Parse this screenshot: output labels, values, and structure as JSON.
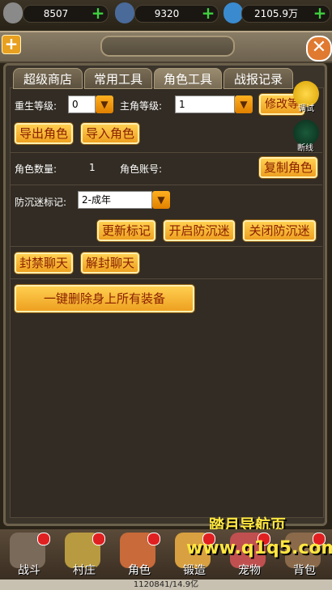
{
  "resources": [
    {
      "icon": "coin-icon",
      "value": "8507"
    },
    {
      "icon": "crystal-icon",
      "value": "9320"
    },
    {
      "icon": "gem-icon",
      "value": "2105.9万"
    }
  ],
  "tabs": [
    "超级商店",
    "常用工具",
    "角色工具",
    "战报记录"
  ],
  "form": {
    "rebirth_label": "重生等级:",
    "rebirth_value": "0",
    "main_level_label": "主角等级:",
    "main_level_value": "1",
    "modify_button": "修改等",
    "debug_label": "调试",
    "export_button": "导出角色",
    "import_button": "导入角色",
    "disconnect_label": "断线",
    "role_count_label": "角色数量:",
    "role_count_value": "1",
    "role_account_label": "角色账号:",
    "copy_role_button": "复制角色",
    "anti_addiction_label": "防沉迷标记:",
    "anti_addiction_value": "2-成年",
    "update_flag_button": "更新标记",
    "enable_anti_button": "开启防沉迷",
    "disable_anti_button": "关闭防沉迷",
    "ban_chat_button": "封禁聊天",
    "unban_chat_button": "解封聊天",
    "delete_equip_button": "一键删除身上所有装备"
  },
  "bottom_nav": [
    {
      "label": "战斗",
      "icon": "battle-icon"
    },
    {
      "label": "村庄",
      "icon": "village-icon"
    },
    {
      "label": "角色",
      "icon": "character-icon"
    },
    {
      "label": "锻造",
      "icon": "forge-icon"
    },
    {
      "label": "宠物",
      "icon": "pet-icon"
    },
    {
      "label": "背包",
      "icon": "bag-icon"
    }
  ],
  "footer_text": "1120841/14.9亿",
  "watermark": {
    "line1": "踏月导航页",
    "line2": "www.q1q5.com"
  },
  "colors": {
    "button": "#eea020",
    "accent_green": "#3fd13f",
    "panel": "#3b342b"
  }
}
